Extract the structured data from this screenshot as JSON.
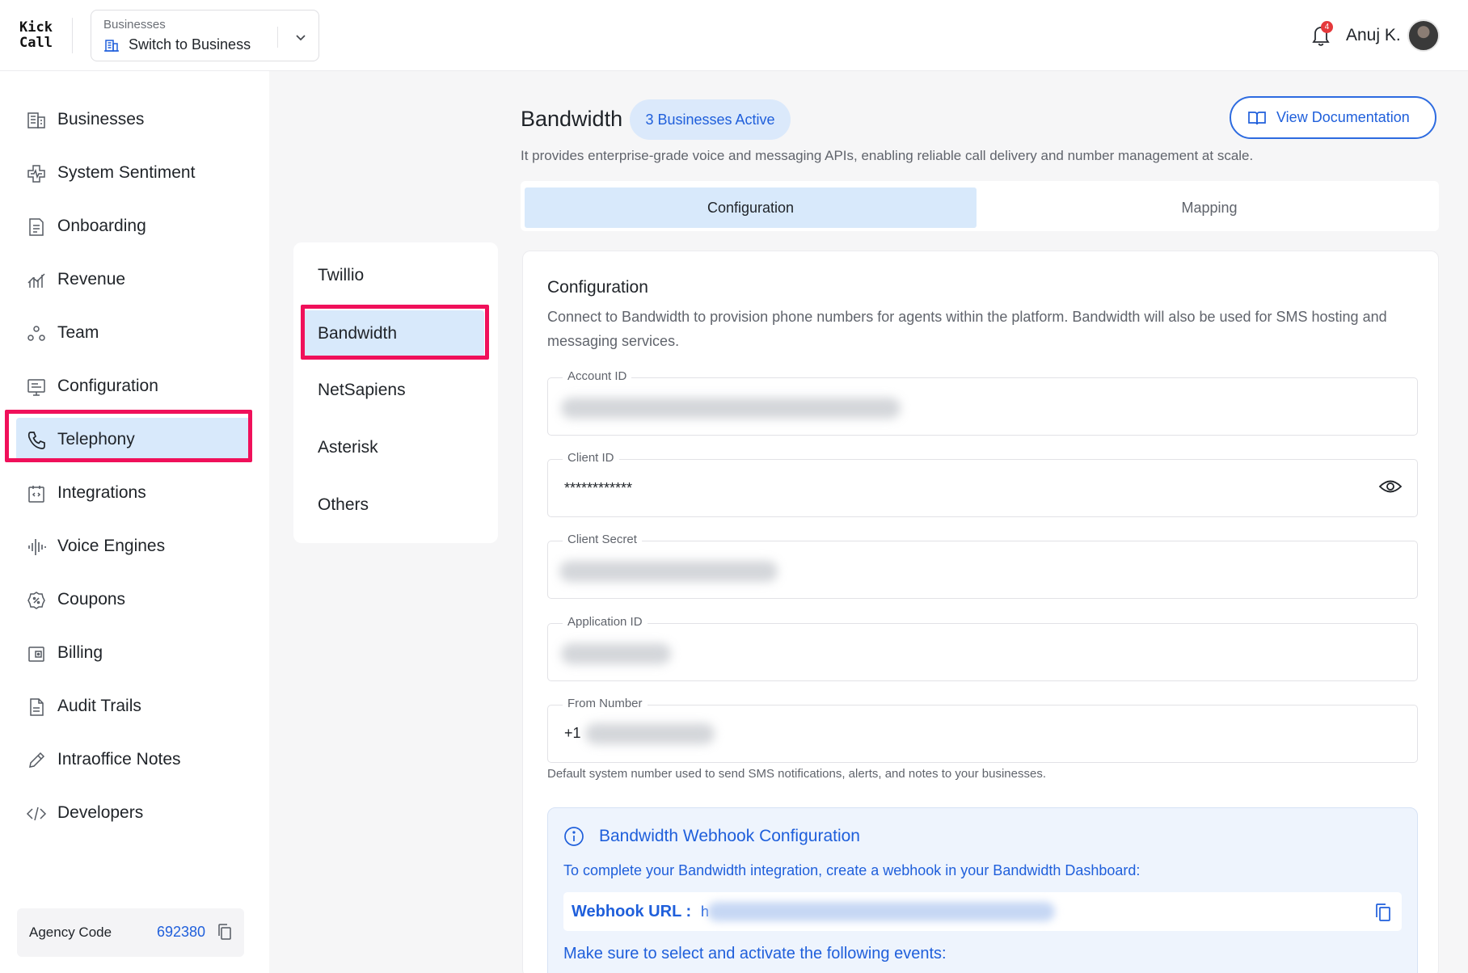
{
  "app": {
    "logo_line1": "Kick",
    "logo_line2": "Call"
  },
  "header": {
    "switcher_label": "Businesses",
    "switcher_value": "Switch to Business",
    "notification_count": "4",
    "user_name": "Anuj K."
  },
  "sidebar": {
    "items": [
      {
        "label": "Businesses",
        "icon": "building-grid-icon"
      },
      {
        "label": "System Sentiment",
        "icon": "health-plus-icon"
      },
      {
        "label": "Onboarding",
        "icon": "document-icon"
      },
      {
        "label": "Revenue",
        "icon": "chart-icon"
      },
      {
        "label": "Team",
        "icon": "team-icon"
      },
      {
        "label": "Configuration",
        "icon": "monitor-icon"
      },
      {
        "label": "Telephony",
        "icon": "phone-icon"
      },
      {
        "label": "Integrations",
        "icon": "code-box-icon"
      },
      {
        "label": "Voice Engines",
        "icon": "waveform-icon"
      },
      {
        "label": "Coupons",
        "icon": "coupon-icon"
      },
      {
        "label": "Billing",
        "icon": "wallet-icon"
      },
      {
        "label": "Audit Trails",
        "icon": "file-icon"
      },
      {
        "label": "Intraoffice Notes",
        "icon": "pencil-icon"
      },
      {
        "label": "Developers",
        "icon": "code-icon"
      }
    ],
    "active": "Telephony",
    "agency_label": "Agency Code",
    "agency_code": "692380"
  },
  "providers": {
    "items": [
      "Twillio",
      "Bandwidth",
      "NetSapiens",
      "Asterisk",
      "Others"
    ],
    "active": "Bandwidth"
  },
  "main": {
    "title": "Bandwidth",
    "badge": "3 Businesses Active",
    "doc_button": "View Documentation",
    "subtitle": "It provides enterprise-grade voice and messaging APIs, enabling reliable call delivery and number management at scale.",
    "tabs": [
      {
        "label": "Configuration",
        "active": true
      },
      {
        "label": "Mapping",
        "active": false
      }
    ]
  },
  "config": {
    "title": "Configuration",
    "description": "Connect to Bandwidth to provision phone numbers for agents within the platform. Bandwidth will also be used for SMS hosting and messaging services.",
    "fields": {
      "account_id": {
        "label": "Account ID",
        "value": ""
      },
      "client_id": {
        "label": "Client ID",
        "value": "************"
      },
      "client_secret": {
        "label": "Client Secret",
        "value": ""
      },
      "application_id": {
        "label": "Application ID",
        "value": ""
      },
      "from_number": {
        "label": "From Number",
        "value": "+1"
      }
    },
    "from_number_helper": "Default system number used to send SMS notifications, alerts, and notes to your businesses."
  },
  "webhook": {
    "title": "Bandwidth Webhook Configuration",
    "description": "To complete your Bandwidth integration, create a webhook in your Bandwidth Dashboard:",
    "url_label": "Webhook URL :",
    "url_value": "h",
    "events_text": "Make sure to select and activate the following events:"
  },
  "colors": {
    "accent": "#1f5fdb",
    "active_bg": "#d8e9fb",
    "highlight": "#f0105a",
    "badge": "#e5383b"
  }
}
